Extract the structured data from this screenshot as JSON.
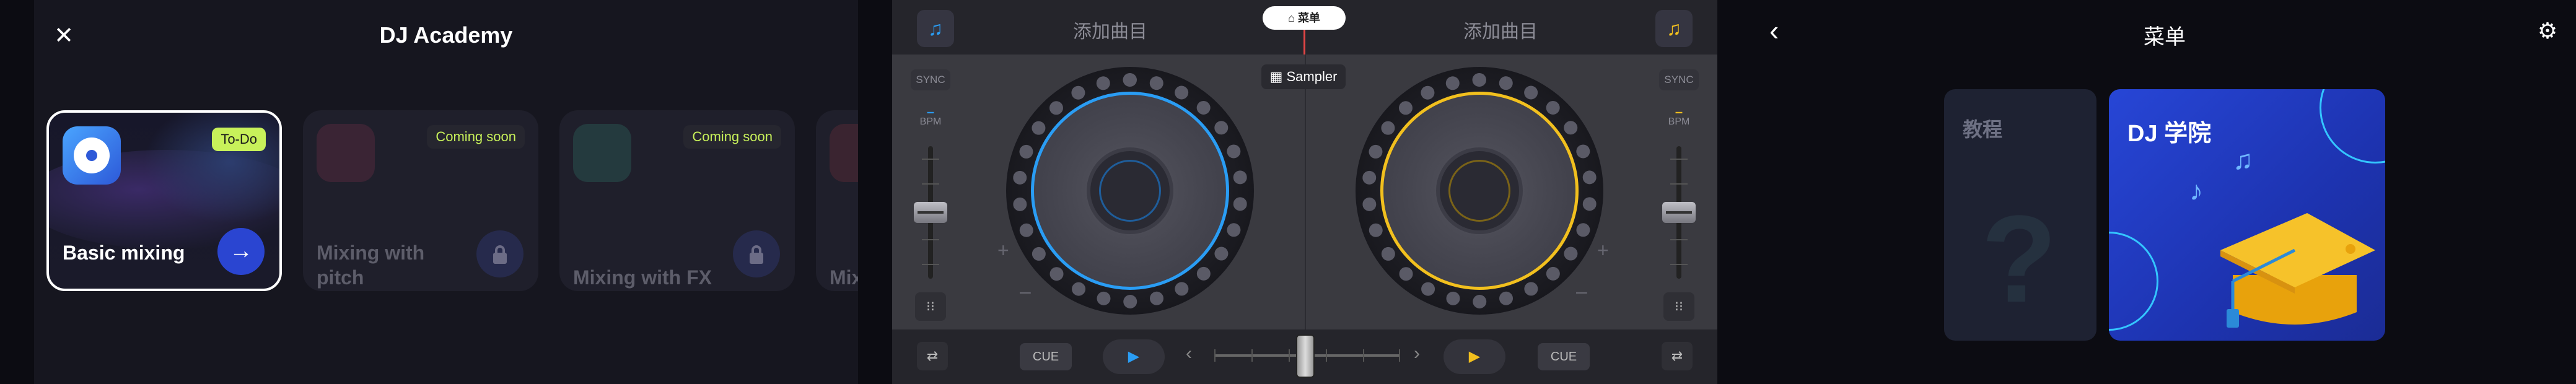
{
  "academy": {
    "title": "DJ Academy",
    "close_icon": "close-icon",
    "cards": [
      {
        "title": "Basic mixing",
        "badge": "To-Do",
        "action_icon": "arrow-right-icon"
      },
      {
        "title": "Mixing with pitch",
        "badge": "Coming soon",
        "action_icon": "lock-icon"
      },
      {
        "title": "Mixing with FX",
        "badge": "Coming soon",
        "action_icon": "lock-icon"
      },
      {
        "title": "Mix filte",
        "badge": "",
        "action_icon": ""
      }
    ]
  },
  "mixer": {
    "add_track_left": "添加曲目",
    "add_track_right": "添加曲目",
    "menu_label": "菜单",
    "sampler_label": "Sampler",
    "sync_left": "SYNC",
    "sync_right": "SYNC",
    "bpm_left": "BPM",
    "bpm_right": "BPM",
    "bpm_value_left": "–",
    "bpm_value_right": "–",
    "cue_left": "CUE",
    "cue_right": "CUE",
    "deck_left_color": "#2a9df4",
    "deck_right_color": "#f2c01e"
  },
  "menu": {
    "title": "菜单",
    "cards": [
      {
        "label": "教程"
      },
      {
        "label": "DJ 学院"
      }
    ]
  }
}
